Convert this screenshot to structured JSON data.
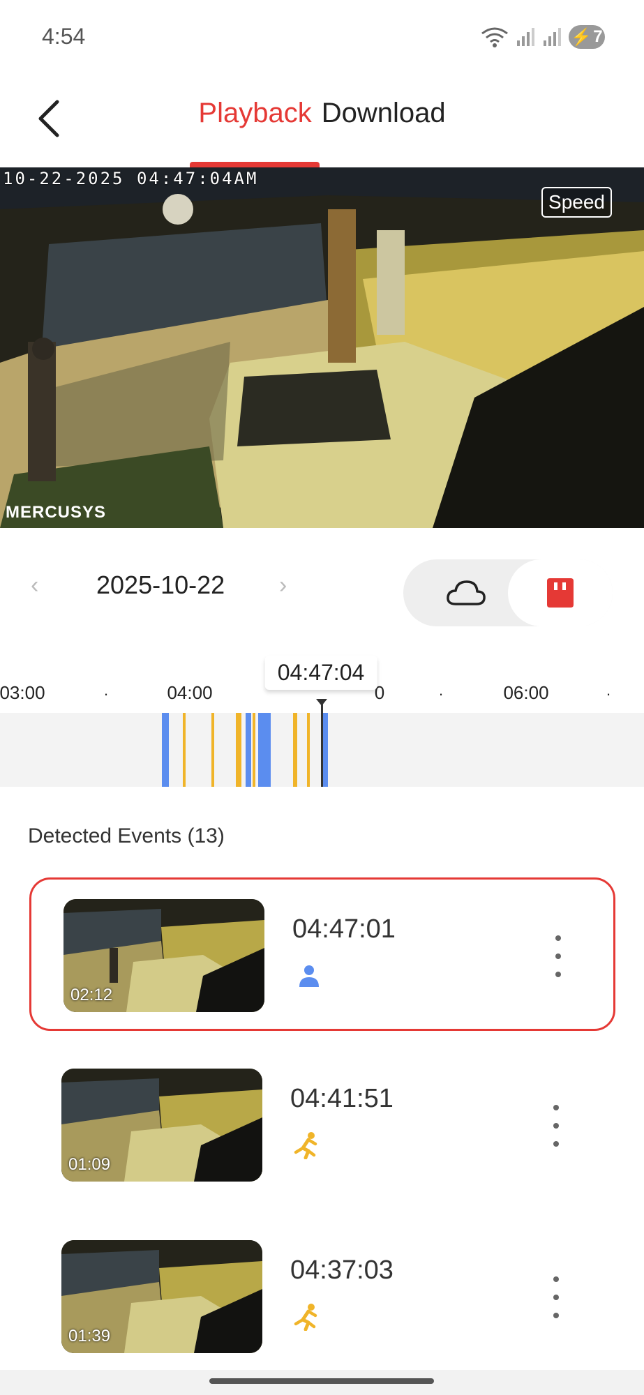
{
  "status_bar": {
    "time": "4:54",
    "battery": "7"
  },
  "header": {
    "tabs": [
      {
        "label": "Playback",
        "active": true
      },
      {
        "label": "Download",
        "active": false
      }
    ]
  },
  "video": {
    "timestamp_overlay": "10-22-2025 04:47:04AM",
    "speed_label": "Speed",
    "watermark": "MERCUSYS"
  },
  "date_bar": {
    "date": "2025-10-22",
    "storage_options": [
      "cloud-icon",
      "sd-card-icon"
    ],
    "selected_storage": "sd-card"
  },
  "timeline": {
    "tick_labels": [
      "03:00",
      "04:00",
      "0",
      "06:00"
    ],
    "cursor_time": "04:47:04",
    "colors": {
      "person": "#5b8def",
      "motion": "#f0b429"
    }
  },
  "events": {
    "title": "Detected Events (13)",
    "items": [
      {
        "time": "04:47:01",
        "duration": "02:12",
        "type": "person",
        "type_icon": "person-icon",
        "selected": true
      },
      {
        "time": "04:41:51",
        "duration": "01:09",
        "type": "motion",
        "type_icon": "running-person-icon",
        "selected": false
      },
      {
        "time": "04:37:03",
        "duration": "01:39",
        "type": "motion",
        "type_icon": "running-person-icon",
        "selected": false
      }
    ]
  },
  "colors": {
    "accent": "#e53935",
    "person": "#5b8def",
    "motion": "#f0b429"
  }
}
